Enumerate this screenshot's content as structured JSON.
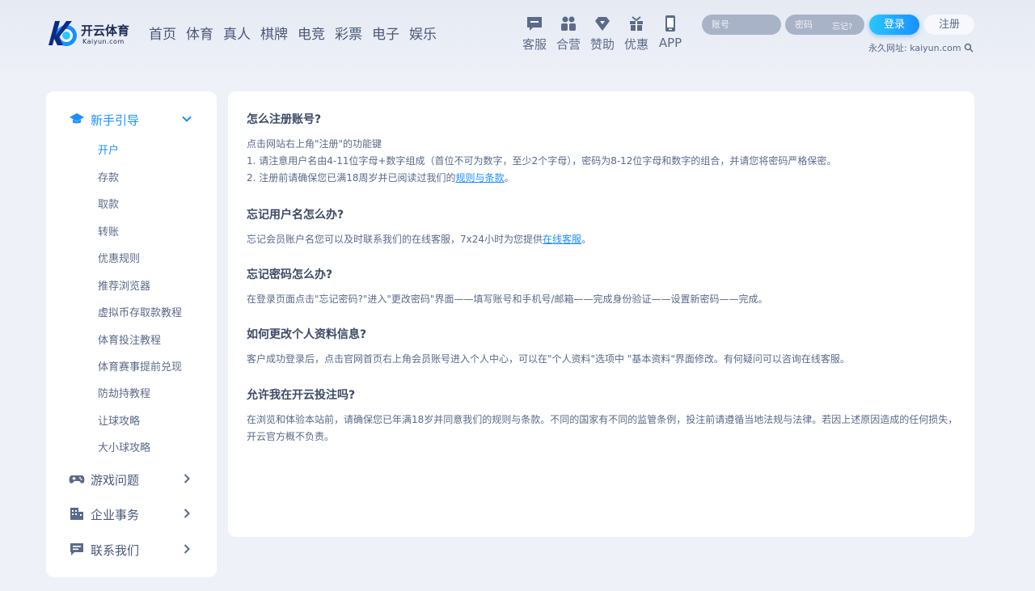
{
  "brand": {
    "name_cn": "开云体育",
    "name_en": "Kaiyun.com"
  },
  "nav": [
    "首页",
    "体育",
    "真人",
    "棋牌",
    "电竞",
    "彩票",
    "电子",
    "娱乐"
  ],
  "quick_links": [
    {
      "label": "客服",
      "icon": "chat-icon"
    },
    {
      "label": "合营",
      "icon": "partner-icon"
    },
    {
      "label": "赞助",
      "icon": "diamond-icon"
    },
    {
      "label": "优惠",
      "icon": "gift-icon"
    },
    {
      "label": "APP",
      "icon": "phone-icon"
    }
  ],
  "login": {
    "account_placeholder": "账号",
    "password_placeholder": "密码",
    "forgot": "忘记?",
    "login_label": "登录",
    "register_label": "注册"
  },
  "permanent_url": "永久网址: kaiyun.com",
  "sidebar": {
    "sections": [
      {
        "label": "新手引导",
        "icon": "graduation-cap-icon",
        "expanded": true,
        "items": [
          "开户",
          "存款",
          "取款",
          "转账",
          "优惠规则",
          "推荐浏览器",
          "虚拟币存取款教程",
          "体育投注教程",
          "体育赛事提前兑现",
          "防劫持教程",
          "让球攻略",
          "大小球攻略"
        ]
      },
      {
        "label": "游戏问题",
        "icon": "gamepad-icon",
        "expanded": false
      },
      {
        "label": "企业事务",
        "icon": "building-icon",
        "expanded": false
      },
      {
        "label": "联系我们",
        "icon": "message-icon",
        "expanded": false
      }
    ],
    "active_item": "开户"
  },
  "content": {
    "q1": {
      "title": "怎么注册账号?",
      "l1": "点击网站右上角\"注册\"的功能键",
      "l2": "1. 请注意用户名由4-11位字母+数字组成（首位不可为数字，至少2个字母），密码为8-12位字母和数字的组合，并请您将密码严格保密。",
      "l3_pre": "2. 注册前请确保您已满18周岁并已阅读过我们的",
      "l3_link": "规则与条款",
      "l3_post": "。"
    },
    "q2": {
      "title": "忘记用户名怎么办?",
      "l1_pre": "忘记会员账户名您可以及时联系我们的在线客服，7x24小时为您提供",
      "l1_link": "在线客服",
      "l1_post": "。"
    },
    "q3": {
      "title": "忘记密码怎么办?",
      "l1": "在登录页面点击\"忘记密码?\"进入\"更改密码\"界面——填写账号和手机号/邮箱——完成身份验证——设置新密码——完成。"
    },
    "q4": {
      "title": "如何更改个人资料信息?",
      "l1": "客户成功登录后，点击官网首页右上角会员账号进入个人中心，可以在\"个人资料\"选项中 \"基本资料\"界面修改。有何疑问可以咨询在线客服。"
    },
    "q5": {
      "title": "允许我在开云投注吗?",
      "l1": "在浏览和体验本站前，请确保您已年满18岁并同意我们的规则与条款。不同的国家有不同的监管条例，投注前请遵循当地法规与法律。若因上述原因造成的任何损失，开云官方概不负责。"
    }
  },
  "colors": {
    "accent": "#1a8fff",
    "text": "#3d4a66",
    "muted": "#5a6a8a",
    "bg": "#eef1f8"
  }
}
